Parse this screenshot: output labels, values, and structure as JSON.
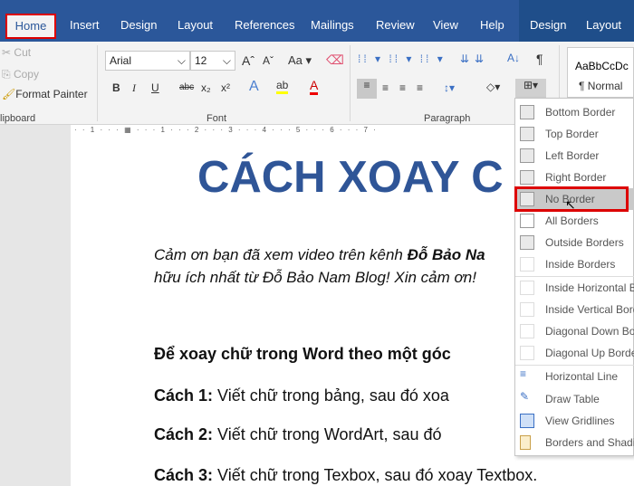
{
  "tabs": [
    "Home",
    "Insert",
    "Design",
    "Layout",
    "References",
    "Mailings",
    "Review",
    "View",
    "Help",
    "Design",
    "Layout"
  ],
  "clipboard": {
    "cut": "Cut",
    "copy": "Copy",
    "format_painter": "Format Painter",
    "group": "lipboard"
  },
  "font": {
    "name": "Arial",
    "size": "12",
    "case": "Aa",
    "bold": "B",
    "italic": "I",
    "underline": "U",
    "strike": "abc",
    "sub": "x₂",
    "sup": "x²",
    "group": "Font"
  },
  "paragraph": {
    "group": "Paragraph",
    "pilcrow": "¶"
  },
  "styles": {
    "preview": "AaBbCcDc",
    "normal": "¶ Normal"
  },
  "ruler": "· · 1 · · · ▦ · · · 1 · · · 2 · · · 3 · · · 4 · · · 5 · · · 6 · · · 7 ·",
  "doc": {
    "title": "CÁCH XOAY C",
    "intro1_a": "Cảm ơn bạn đã xem video trên kênh ",
    "intro1_b": "Đỗ Bảo Na",
    "intro2": "hữu ích nhất từ Đỗ Bảo Nam Blog! Xin cảm ơn!",
    "heading": "Để xoay chữ trong Word theo một góc",
    "c1_label": "Cách 1:",
    "c1": " Viết chữ trong bảng, sau đó xoa",
    "c2_label": "Cách 2:",
    "c2": " Viết chữ trong WordArt, sau đó",
    "c3_label": "Cách 3:",
    "c3": " Viết chữ trong Texbox, sau đó xoay Textbox."
  },
  "menu": [
    "Bottom Border",
    "Top Border",
    "Left Border",
    "Right Border",
    "No Border",
    "All Borders",
    "Outside Borders",
    "Inside Borders",
    "Inside Horizontal Border",
    "Inside Vertical Border",
    "Diagonal Down Border",
    "Diagonal Up Border",
    "Horizontal Line",
    "Draw Table",
    "View Gridlines",
    "Borders and Shading..."
  ],
  "selected_menu_item": "No Border",
  "colors": {
    "accent": "#2b579a",
    "title": "#2f5597",
    "highlight": "#dd0000"
  }
}
